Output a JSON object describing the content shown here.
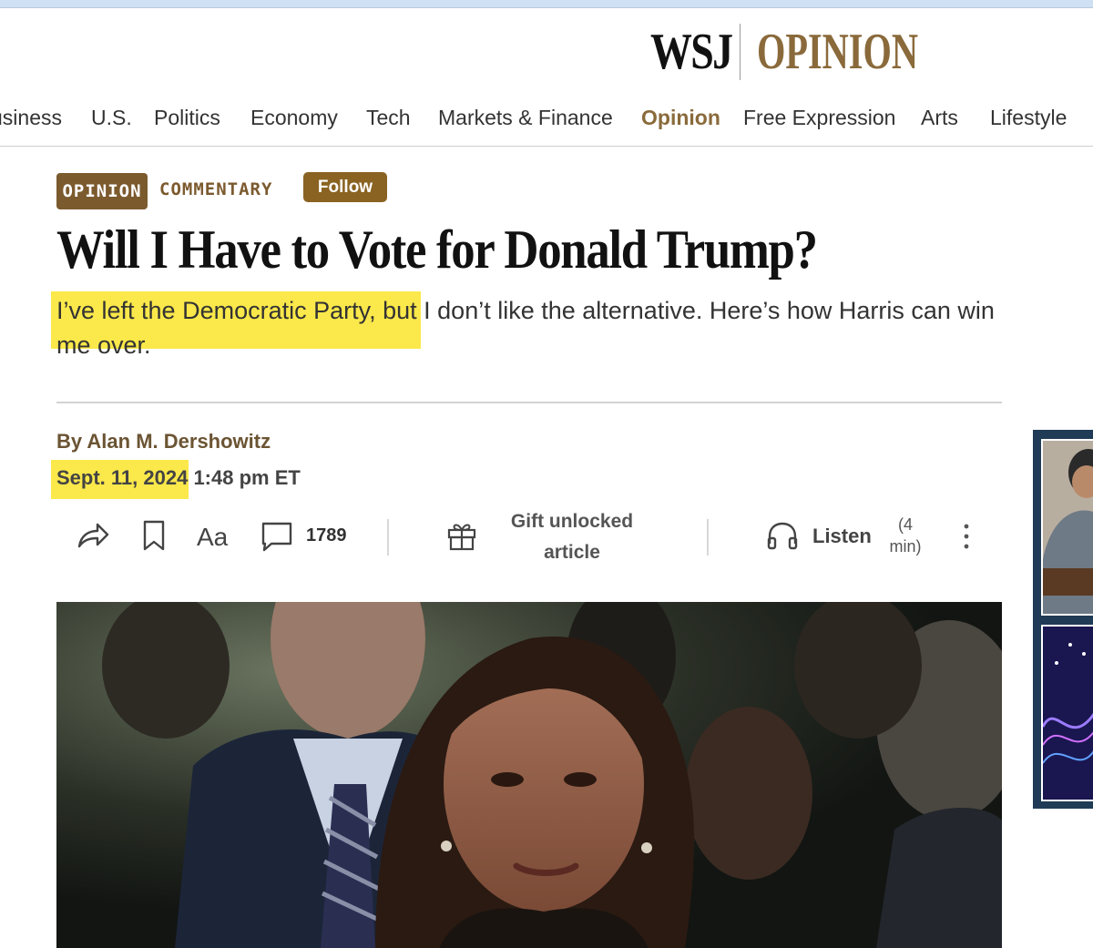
{
  "masthead": {
    "brand": "WSJ",
    "section": "OPINION"
  },
  "nav": {
    "items": [
      "usiness",
      "U.S.",
      "Politics",
      "Economy",
      "Tech",
      "Markets & Finance",
      "Opinion",
      "Free Expression",
      "Arts",
      "Lifestyle"
    ],
    "active": "Opinion"
  },
  "article": {
    "flag": "OPINION",
    "kicker": "COMMENTARY",
    "follow_label": "Follow",
    "headline": "Will I Have to Vote for Donald Trump?",
    "dek": "I’ve left the Democratic Party, but I don’t like the alternative. Here’s how Harris can win me over.",
    "byline": "By Alan M. Dershowitz",
    "date": "Sept. 11, 2024",
    "time": " 1:48 pm ET"
  },
  "toolbar": {
    "comment_count": "1789",
    "gift_label": "Gift unlocked article",
    "listen_label": "Listen",
    "listen_duration": "(4 min)"
  },
  "colors": {
    "accent": "#8a6a3b",
    "flag_bg": "#7b5a2e",
    "highlight": "#fbe84a"
  }
}
